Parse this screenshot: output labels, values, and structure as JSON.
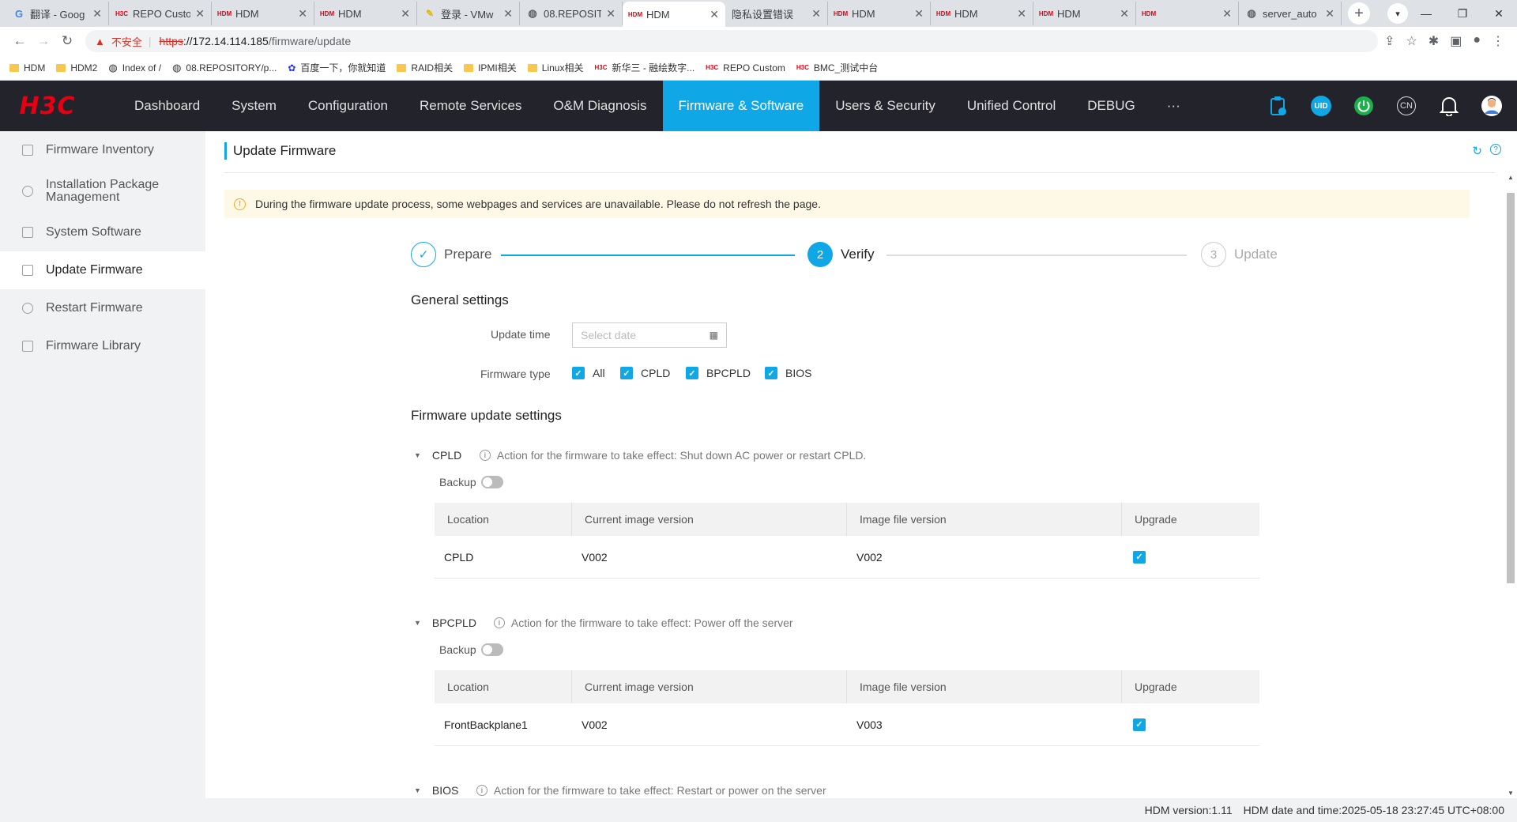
{
  "browser": {
    "tabs": [
      {
        "title": "翻译 - Goog",
        "icon": "google-icon"
      },
      {
        "title": "REPO Custo",
        "icon": "h3c-favicon"
      },
      {
        "title": "HDM",
        "icon": "hdm-favicon"
      },
      {
        "title": "HDM",
        "icon": "hdm-favicon"
      },
      {
        "title": "登录 - VMw",
        "icon": "pencil-favicon"
      },
      {
        "title": "08.REPOSIT",
        "icon": "globe-icon"
      },
      {
        "title": "HDM",
        "icon": "hdm-favicon",
        "active": true
      },
      {
        "title": "隐私设置错误",
        "icon": "none"
      },
      {
        "title": "HDM",
        "icon": "hdm-favicon"
      },
      {
        "title": "HDM",
        "icon": "hdm-favicon"
      },
      {
        "title": "HDM",
        "icon": "hdm-favicon"
      },
      {
        "title": "",
        "icon": "hdm-favicon"
      },
      {
        "title": "server_auto",
        "icon": "globe-icon"
      }
    ],
    "security_label": "不安全",
    "url_scheme": "https",
    "url_rest": "://172.14.114.185",
    "url_path": "/firmware/update",
    "bookmarks": [
      {
        "label": "HDM",
        "icon": "folder"
      },
      {
        "label": "HDM2",
        "icon": "folder"
      },
      {
        "label": "Index of /",
        "icon": "globe"
      },
      {
        "label": "08.REPOSITORY/p...",
        "icon": "globe"
      },
      {
        "label": "百度一下，你就知道",
        "icon": "baidu"
      },
      {
        "label": "RAID相关",
        "icon": "folder"
      },
      {
        "label": "IPMI相关",
        "icon": "folder"
      },
      {
        "label": "Linux相关",
        "icon": "folder"
      },
      {
        "label": "新华三 - 融绘数字...",
        "icon": "h3c"
      },
      {
        "label": "REPO Custom",
        "icon": "h3c"
      },
      {
        "label": "BMC_测试中台",
        "icon": "h3c"
      }
    ]
  },
  "app": {
    "logo": "H3C",
    "nav": [
      "Dashboard",
      "System",
      "Configuration",
      "Remote Services",
      "O&M Diagnosis",
      "Firmware & Software",
      "Users & Security",
      "Unified Control",
      "DEBUG",
      "···"
    ],
    "active_nav": "Firmware & Software",
    "top_icons": [
      "clipboard-icon",
      "uid-icon",
      "power-icon",
      "language-icon",
      "bell-icon",
      "user-avatar-icon"
    ],
    "uid_label": "UID",
    "lang_label": "CN",
    "accent": "#0fa7e6",
    "header_bg": "#23232c"
  },
  "sidebar": {
    "items": [
      {
        "label": "Firmware Inventory"
      },
      {
        "label": "Installation Package Management"
      },
      {
        "label": "System Software"
      },
      {
        "label": "Update Firmware",
        "active": true
      },
      {
        "label": "Restart Firmware"
      },
      {
        "label": "Firmware Library"
      }
    ]
  },
  "page": {
    "title": "Update Firmware",
    "notice": "During the firmware update process, some webpages and services are unavailable. Please do not refresh the page.",
    "steps": [
      {
        "label": "Prepare",
        "state": "done",
        "mark": "✓"
      },
      {
        "label": "Verify",
        "state": "current",
        "mark": "2"
      },
      {
        "label": "Update",
        "state": "todo",
        "mark": "3"
      }
    ],
    "general_title": "General settings",
    "update_time_label": "Update time",
    "update_time_placeholder": "Select date",
    "firmware_type_label": "Firmware type",
    "firmware_types": [
      "All",
      "CPLD",
      "BPCPLD",
      "BIOS"
    ],
    "update_settings_title": "Firmware update settings",
    "backup_label": "Backup",
    "columns": [
      "Location",
      "Current image version",
      "Image file version",
      "Upgrade"
    ],
    "groups": [
      {
        "name": "CPLD",
        "action": "Action for the firmware to take effect: Shut down AC power or restart CPLD.",
        "backup": false,
        "rows": [
          {
            "location": "CPLD",
            "current": "V002",
            "file": "V002",
            "upgrade": true
          }
        ]
      },
      {
        "name": "BPCPLD",
        "action": "Action for the firmware to take effect: Power off the server",
        "backup": false,
        "rows": [
          {
            "location": "FrontBackplane1",
            "current": "V002",
            "file": "V003",
            "upgrade": true
          }
        ]
      },
      {
        "name": "BIOS",
        "action": "Action for the firmware to take effect: Restart or power on the server"
      }
    ]
  },
  "footer": {
    "version": "HDM version:1.11",
    "datetime": "HDM date and time:2025-05-18 23:27:45 UTC+08:00"
  }
}
